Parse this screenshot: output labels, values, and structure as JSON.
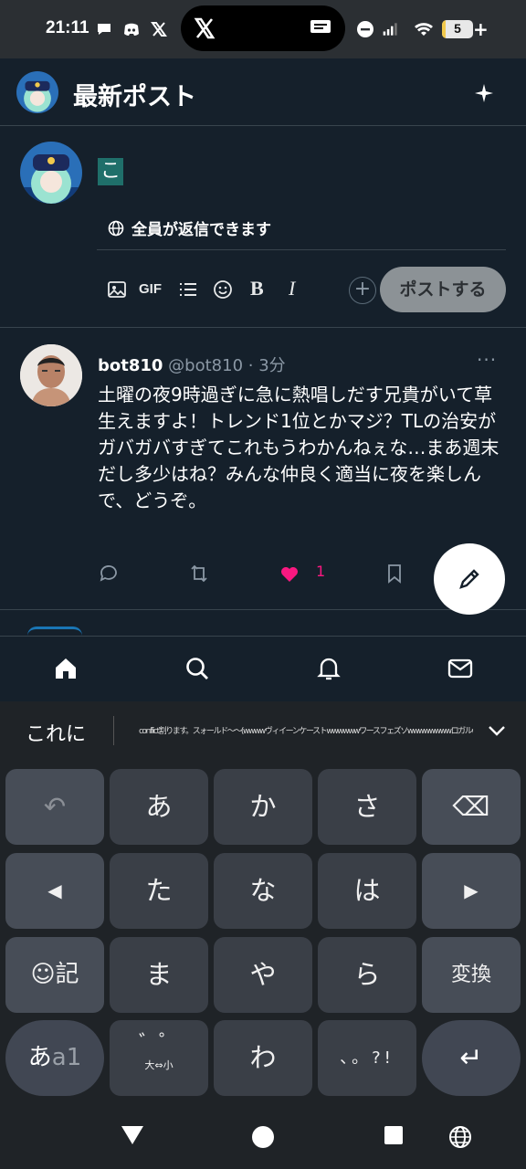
{
  "status_bar": {
    "time": "21:11",
    "battery_percent": "5",
    "battery_level": 0.05
  },
  "header": {
    "title": "最新ポスト"
  },
  "composer": {
    "text": "こ",
    "reply_setting": "全員が返信できます",
    "tools": [
      "image-icon",
      "GIF",
      "list-icon",
      "emoji-icon",
      "B",
      "I"
    ],
    "post_button": "ポストする"
  },
  "tweet": {
    "name": "bot810",
    "handle": "@bot810",
    "time": "3分",
    "body": "土曜の夜9時過ぎに急に熱唱しだす兄貴がいて草生えますよ！トレンド1位とかマジ？TLの治安がガバガバすぎてこれもうわかんねぇな…まあ週末だし多少はね？みんな仲良く適当に夜を楽しんで、どうぞ。",
    "like_count": "1"
  },
  "bottom_nav": [
    "home-icon",
    "search-icon",
    "notifications-icon",
    "messages-icon"
  ],
  "keyboard": {
    "candidate_main": "これに",
    "candidate_scroll": "conflict割ります。スォールド〜〜(wwwwヴィイーンケーストwwwwwwワースフェズソwwwwwwwwロガルwwwwwwブロークエブwwwwwwwダレフェスォーイヴァーwwwwwv",
    "keys": {
      "r1": [
        "↶",
        "あ",
        "か",
        "さ",
        "⌫"
      ],
      "r2": [
        "◀",
        "た",
        "な",
        "は",
        "▶"
      ],
      "r3": [
        "☺記",
        "ま",
        "や",
        "ら",
        "変換"
      ],
      "r4_mode": "あ",
      "r4_mode_sub": "a1",
      "r4_dakuten": "゛゜",
      "r4_dakuten_sub": "大⇔小",
      "r4_wa": "わ",
      "r4_punct": "、。?!",
      "r4_enter": "↵"
    }
  }
}
